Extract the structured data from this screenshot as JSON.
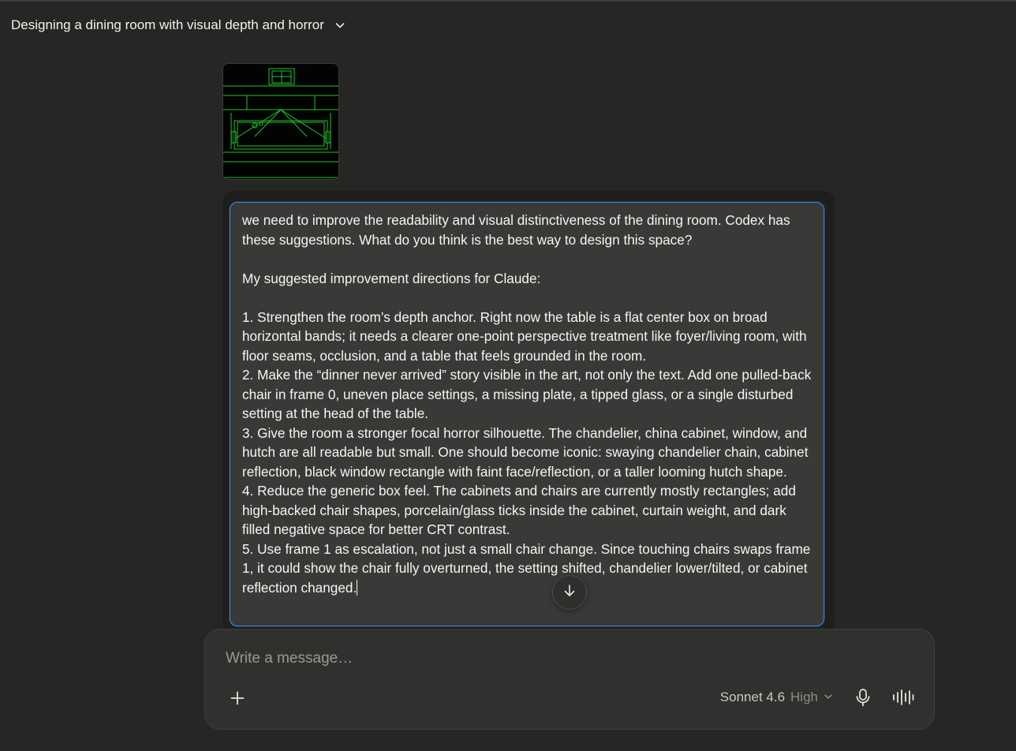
{
  "conversation": {
    "title": "Designing a dining room with visual depth and horror"
  },
  "attachment": {
    "kind": "image",
    "icon": "wireframe-dining-room-thumbnail"
  },
  "edit_message": {
    "text": "we need to improve the readability and visual distinctiveness of the dining room. Codex has these suggestions. What do you think is the best way to design this space?\n\nMy suggested improvement directions for Claude:\n\n1. Strengthen the room’s depth anchor. Right now the table is a flat center box on broad horizontal bands; it needs a clearer one-point perspective treatment like foyer/living room, with floor seams, occlusion, and a table that feels grounded in the room.\n2. Make the “dinner never arrived” story visible in the art, not only the text. Add one pulled-back chair in frame 0, uneven place settings, a missing plate, a tipped glass, or a single disturbed setting at the head of the table.\n3. Give the room a stronger focal horror silhouette. The chandelier, china cabinet, window, and hutch are all readable but small. One should become iconic: swaying chandelier chain, cabinet reflection, black window rectangle with faint face/reflection, or a taller looming hutch shape.\n4. Reduce the generic box feel. The cabinets and chairs are currently mostly rectangles; add high-backed chair shapes, porcelain/glass ticks inside the cabinet, curtain weight, and dark filled negative space for better CRT contrast.\n5. Use frame 1 as escalation, not just a small chair change. Since touching chairs swaps frame 1, it could show the chair fully overturned, the setting shifted, chandelier lower/tilted, or cabinet reflection changed.",
    "border_color": "#3b82e8"
  },
  "composer": {
    "placeholder": "Write a message…",
    "model_name": "Sonnet 4.6",
    "effort": "High"
  },
  "colors": {
    "background": "#262624",
    "composer_bg": "#30302e",
    "wireframe_green": "#22c02a"
  }
}
